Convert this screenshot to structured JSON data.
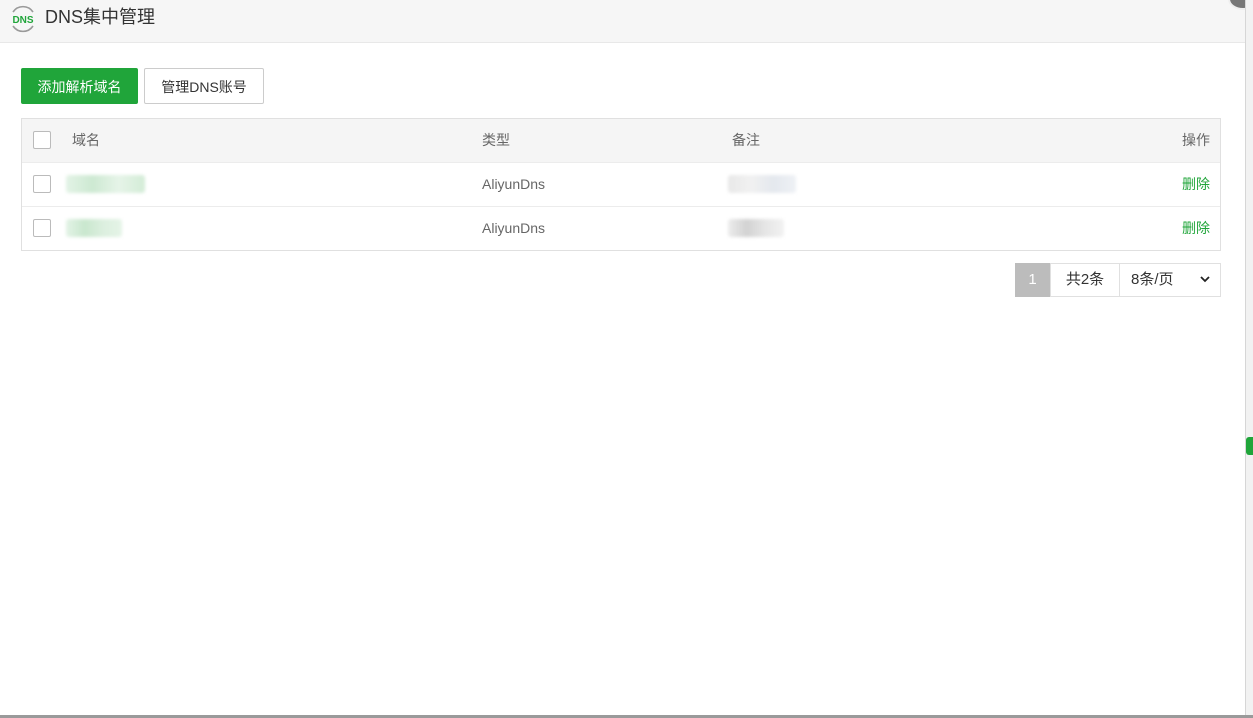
{
  "header": {
    "logo_text": "DNS",
    "title": "DNS集中管理"
  },
  "toolbar": {
    "add_label": "添加解析域名",
    "manage_label": "管理DNS账号"
  },
  "table": {
    "columns": {
      "name": "域名",
      "type": "类型",
      "note": "备注",
      "op": "操作"
    },
    "rows": [
      {
        "type": "AliyunDns",
        "delete_label": "删除"
      },
      {
        "type": "AliyunDns",
        "delete_label": "删除"
      }
    ]
  },
  "pagination": {
    "current_page": "1",
    "total": "共2条",
    "page_size": "8条/页"
  },
  "colors": {
    "accent": "#20a53a"
  }
}
